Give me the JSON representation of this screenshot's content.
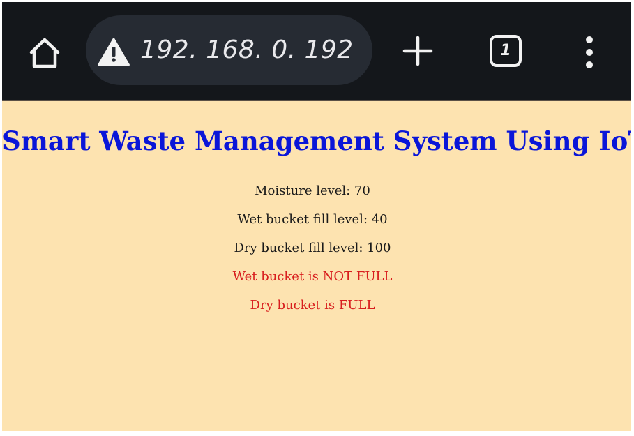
{
  "browser": {
    "url": "192. 168. 0. 192",
    "tab_count": "1",
    "icons": [
      "home-icon",
      "warning-icon",
      "plus-icon",
      "tabs-icon",
      "more-vertical-icon"
    ]
  },
  "page": {
    "title": "Smart Waste Management System Using IoT",
    "moisture": "Moisture level: 70",
    "wet_fill": "Wet bucket fill level: 40",
    "dry_fill": "Dry bucket fill level: 100",
    "wet_status": "Wet bucket is NOT FULL",
    "dry_status": "Dry bucket is FULL"
  },
  "colors": {
    "toolbar_bg": "#14171b",
    "urlbar_bg": "#262b33",
    "page_bg": "#fde3b0",
    "title": "#0a16d8",
    "status_red": "#d81e1e"
  }
}
